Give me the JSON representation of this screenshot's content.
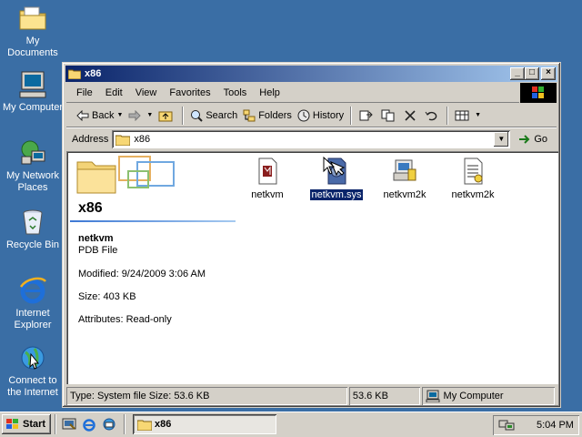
{
  "desktop": {
    "icons": [
      {
        "label_line1": "My Documents",
        "label_line2": "",
        "icon": "my-documents-icon"
      },
      {
        "label_line1": "My Computer",
        "label_line2": "",
        "icon": "my-computer-icon"
      },
      {
        "label_line1": "My Network",
        "label_line2": "Places",
        "icon": "network-places-icon"
      },
      {
        "label_line1": "Recycle Bin",
        "label_line2": "",
        "icon": "recycle-bin-icon"
      },
      {
        "label_line1": "Internet",
        "label_line2": "Explorer",
        "icon": "internet-explorer-icon"
      },
      {
        "label_line1": "Connect to",
        "label_line2": "the Internet",
        "icon": "connect-internet-icon"
      }
    ]
  },
  "window": {
    "title": "x86",
    "buttons": {
      "minimize": "_",
      "maximize": "□",
      "close": "×"
    }
  },
  "menu": {
    "items": [
      "File",
      "Edit",
      "View",
      "Favorites",
      "Tools",
      "Help"
    ]
  },
  "toolbar": {
    "back": "Back",
    "search": "Search",
    "folders": "Folders",
    "history": "History"
  },
  "address": {
    "label": "Address",
    "value": "x86",
    "go": "Go"
  },
  "left_pane": {
    "folder_title": "x86",
    "file_name": "netkvm",
    "file_type": "PDB File",
    "modified": "Modified: 9/24/2009 3:06 AM",
    "size": "Size: 403 KB",
    "attributes": "Attributes: Read-only"
  },
  "files": [
    {
      "name": "netkvm",
      "icon": "pdb-file-icon",
      "selected": false
    },
    {
      "name": "netkvm.sys",
      "icon": "system-file-icon",
      "selected": true
    },
    {
      "name": "netkvm2k",
      "icon": "setup-file-icon",
      "selected": false
    },
    {
      "name": "netkvm2k",
      "icon": "inf-file-icon",
      "selected": false
    }
  ],
  "status": {
    "info": "Type: System file Size: 53.6 KB",
    "size": "53.6 KB",
    "zone": "My Computer"
  },
  "taskbar": {
    "start": "Start",
    "task": "x86",
    "clock": "5:04 PM"
  },
  "colors": {
    "desktop": "#3a6ea5",
    "title_start": "#0a246a",
    "title_end": "#a6caf0",
    "selection": "#0a246a",
    "face": "#d4d0c8"
  }
}
